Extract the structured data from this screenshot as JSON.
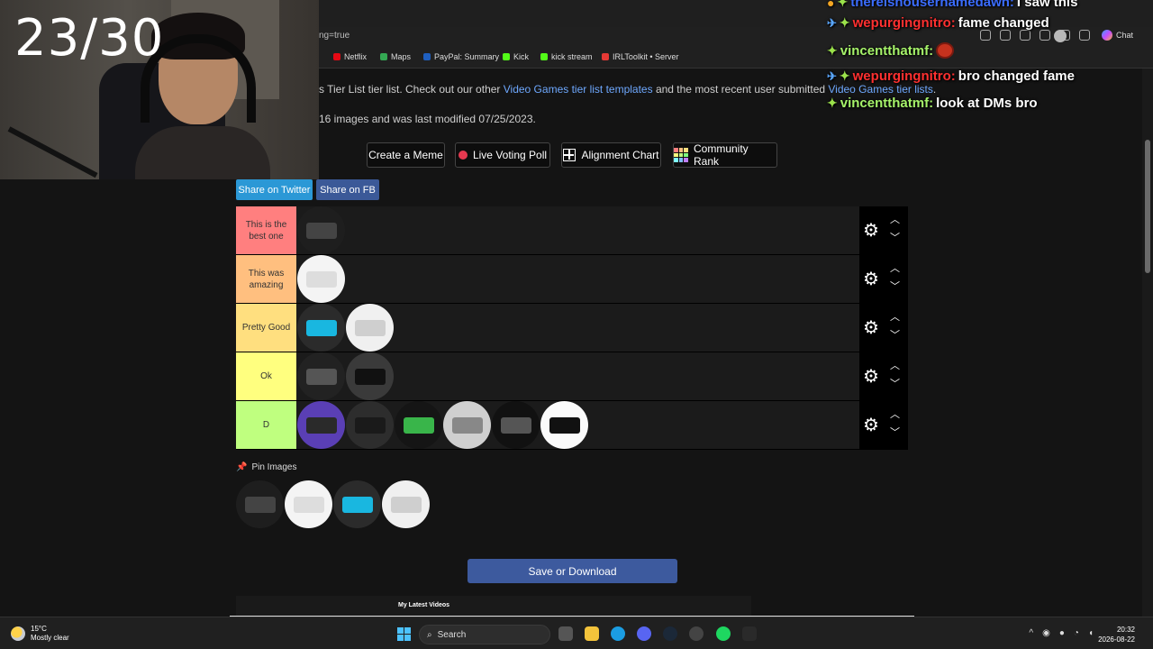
{
  "browser": {
    "url_fragment": "ng=true",
    "chat_label": "Chat",
    "bookmarks": [
      {
        "label": "Netflix",
        "color": "#e50914"
      },
      {
        "label": "Maps",
        "color": "#34a853"
      },
      {
        "label": "PayPal: Summary",
        "color": "#1f5fbf"
      },
      {
        "label": "Kick",
        "color": "#53fc18"
      },
      {
        "label": "kick stream",
        "color": "#53fc18"
      },
      {
        "label": "IRLToolkit • Server",
        "color": "#e53935"
      }
    ]
  },
  "page": {
    "desc1_prefix": "s Tier List tier list. Check out our other ",
    "desc1_link1": "Video Games tier list templates",
    "desc1_mid": " and the most recent user submitted ",
    "desc1_link2": "Video Games tier lists",
    "desc1_end": ".",
    "desc2": "16 images and was last modified 07/25/2023.",
    "actions": {
      "create_meme": "Create a Meme",
      "live_voting": "Live Voting Poll",
      "alignment_chart": "Alignment Chart",
      "community_rank": "Community Rank"
    },
    "share_twitter": "Share on Twitter",
    "share_fb": "Share on FB",
    "tiers": [
      {
        "label": "This is the best one",
        "color": "#ff7f7f",
        "item_count": 1
      },
      {
        "label": "This was amazing",
        "color": "#ffbf7f",
        "item_count": 1
      },
      {
        "label": "Pretty Good",
        "color": "#ffdf7f",
        "item_count": 2
      },
      {
        "label": "Ok",
        "color": "#ffff7f",
        "item_count": 2
      },
      {
        "label": "D",
        "color": "#bfff7f",
        "item_count": 6
      }
    ],
    "pin_label": "Pin Images",
    "pinned_count": 4,
    "save_label": "Save or Download",
    "latest_label": "My Latest Videos"
  },
  "stream": {
    "counter": "23/30",
    "chat": [
      {
        "user": "therelsnousernamedawn:",
        "message": "I saw this",
        "user_color": "#3b6dff",
        "badges": [
          "emote-badge",
          "green-badge"
        ]
      },
      {
        "user": "wepurgingnitro:",
        "message": "fame changed",
        "user_color": "#ff3030",
        "badges": [
          "sword-badge",
          "green-badge"
        ]
      },
      {
        "user": "vincentthatmf:",
        "message": "",
        "user_color": "#a6f36a",
        "badges": [
          "green-badge"
        ],
        "emote": true
      },
      {
        "user": "wepurgingnitro:",
        "message": "bro changed fame",
        "user_color": "#ff3030",
        "badges": [
          "sword-badge",
          "green-badge"
        ]
      },
      {
        "user": "vincentthatmf:",
        "message": "look at DMs bro",
        "user_color": "#a6f36a",
        "badges": [
          "green-badge"
        ]
      }
    ]
  },
  "taskbar": {
    "temp": "15°C",
    "weather": "Mostly clear",
    "search": "Search",
    "time": "20:32",
    "date": "2026-08-22"
  }
}
